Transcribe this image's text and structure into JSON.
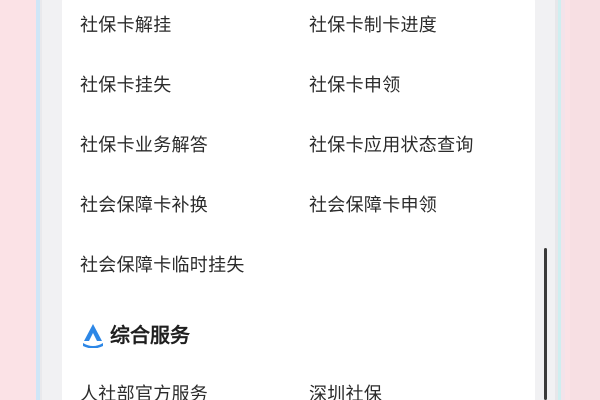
{
  "items": [
    "社保卡解挂",
    "社保卡制卡进度",
    "社保卡挂失",
    "社保卡申领",
    "社保卡业务解答",
    "社保卡应用状态查询",
    "社会保障卡补换",
    "社会保障卡申领",
    "社会保障卡临时挂失"
  ],
  "section": {
    "title": "综合服务",
    "icon": "service-logo-icon",
    "icon_color": "#2d87e6"
  },
  "section_items": [
    "人社部官方服务",
    "深圳社保"
  ]
}
